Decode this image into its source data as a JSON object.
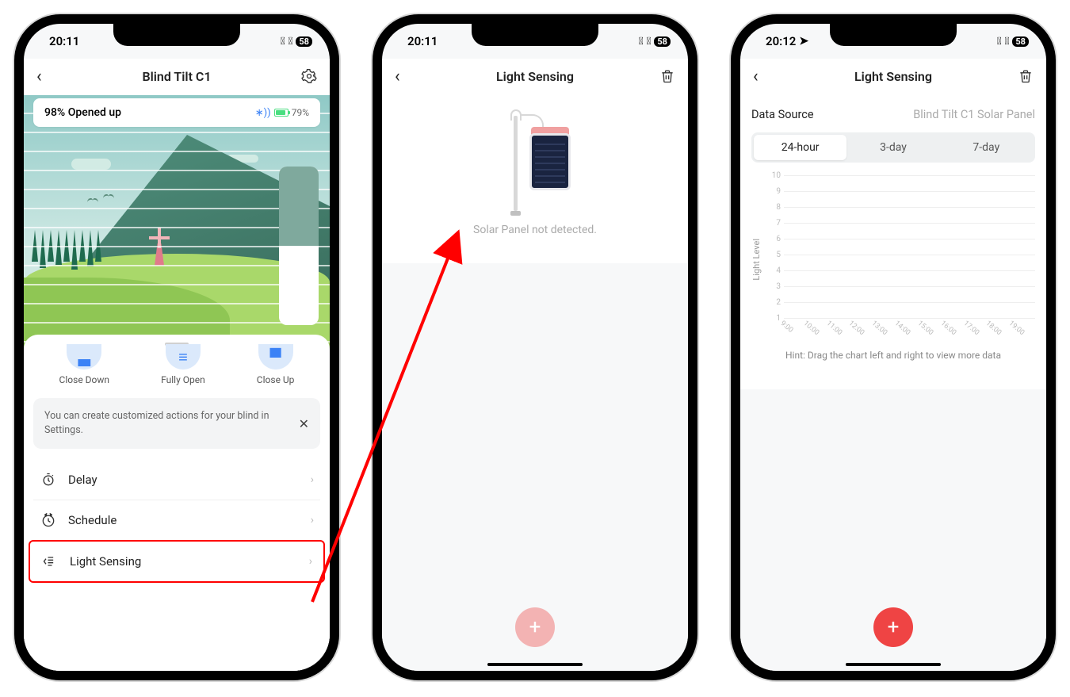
{
  "phone1": {
    "status_time": "20:11",
    "battery_pill": "58",
    "nav_title": "Blind Tilt C1",
    "open_status": "98% Opened up",
    "battery_pct": "79%",
    "actions": [
      {
        "label": "Close Down"
      },
      {
        "label": "Fully Open"
      },
      {
        "label": "Close Up"
      }
    ],
    "tip": "You can create customized actions for your blind in Settings.",
    "menu": {
      "delay": "Delay",
      "schedule": "Schedule",
      "light_sensing": "Light Sensing"
    }
  },
  "phone2": {
    "status_time": "20:11",
    "battery_pill": "58",
    "nav_title": "Light Sensing",
    "empty_msg": "Solar Panel not detected."
  },
  "phone3": {
    "status_time": "20:12",
    "battery_pill": "58",
    "nav_title": "Light Sensing",
    "data_source_label": "Data Source",
    "data_source_value": "Blind Tilt C1 Solar Panel",
    "segments": {
      "a": "24-hour",
      "b": "3-day",
      "c": "7-day"
    },
    "hint": "Hint: Drag the chart left and right to view more data"
  },
  "chart_data": {
    "type": "line",
    "title": "",
    "ylabel": "Light Level",
    "xlabel": "",
    "ylim": [
      1,
      10
    ],
    "y_ticks": [
      10,
      9,
      8,
      7,
      6,
      5,
      4,
      3,
      2,
      1
    ],
    "x_ticks": [
      "9:00",
      "10:00",
      "11:00",
      "12:00",
      "13:00",
      "14:00",
      "15:00",
      "16:00",
      "17:00",
      "18:00",
      "19:00"
    ],
    "series": [
      {
        "name": "Light Level",
        "values": []
      }
    ]
  }
}
